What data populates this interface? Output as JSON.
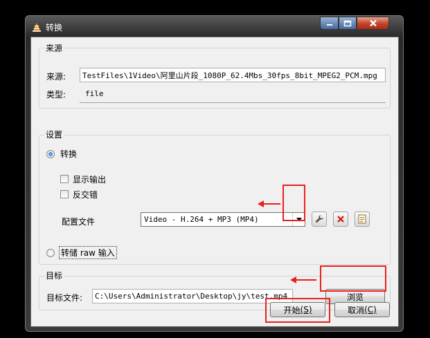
{
  "window": {
    "title": "转换",
    "controls": {
      "minimize_icon": "minimize-icon",
      "maximize_icon": "maximize-icon",
      "close_icon": "close-icon"
    }
  },
  "source": {
    "group_title": "来源",
    "source_label": "来源:",
    "source_value": "TestFiles\\1Video\\阿里山片段_1080P_62.4Mbs_30fps_8bit_MPEG2_PCM.mpg",
    "type_label": "类型:",
    "type_value": "file"
  },
  "settings": {
    "group_title": "设置",
    "convert_label": "转换",
    "convert_selected": true,
    "show_output_label": "显示输出",
    "show_output_checked": false,
    "deinterlace_label": "反交错",
    "deinterlace_checked": false,
    "profile_label": "配置文件",
    "profile_value": "Video - H.264 + MP3 (MP4)",
    "dump_raw_label": "转储 raw 输入",
    "dump_raw_selected": false,
    "tool_icons": [
      "wrench-icon",
      "delete-icon",
      "new-profile-icon"
    ]
  },
  "target": {
    "group_title": "目标",
    "dest_label": "目标文件:",
    "dest_value": "C:\\Users\\Administrator\\Desktop\\jy\\test.mp4",
    "browse_label": "浏览"
  },
  "actions": {
    "start_label": "开始",
    "start_accel": "(S)",
    "cancel_label": "取消",
    "cancel_accel": "(C)"
  },
  "colors": {
    "annotation_red": "#e8201c",
    "radio_blue": "#1e5fcf"
  }
}
